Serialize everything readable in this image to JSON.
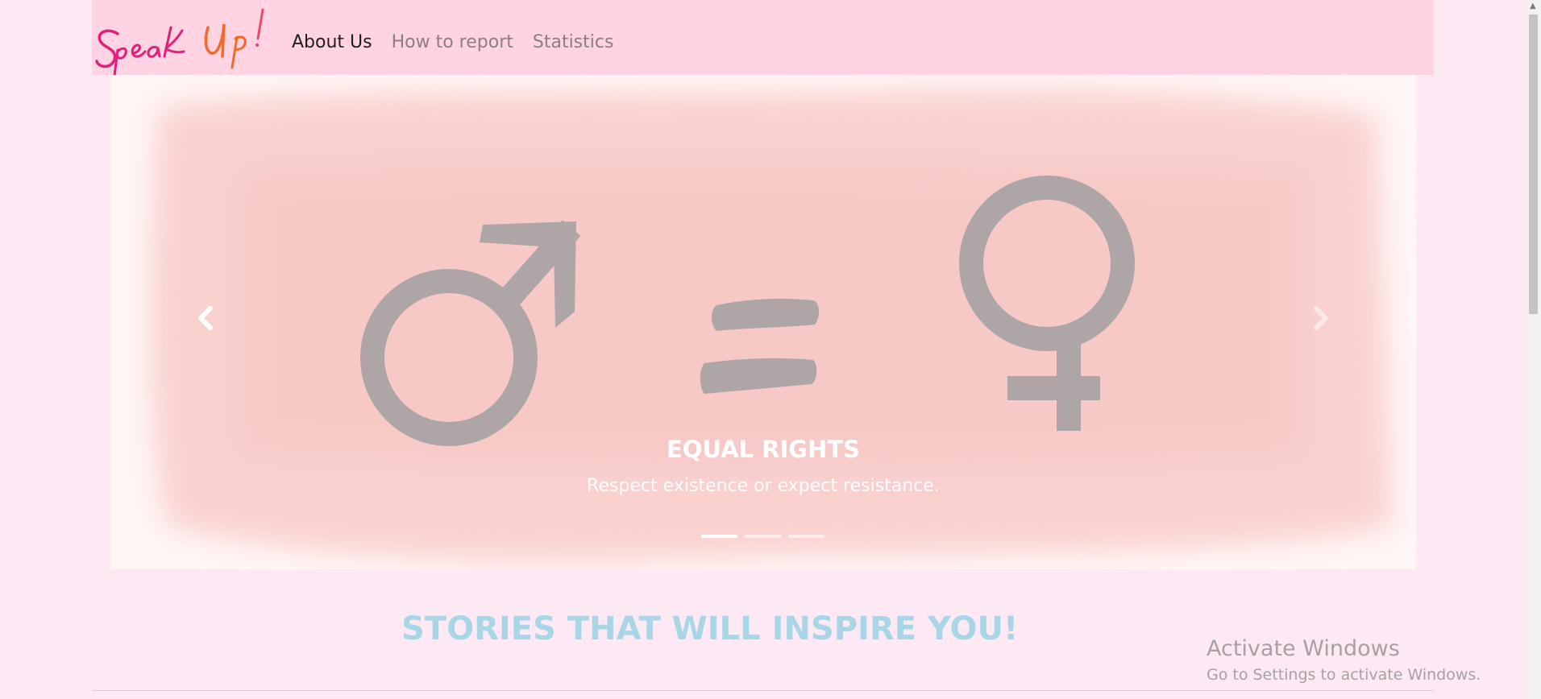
{
  "navbar": {
    "logo_text": "Speak Up!",
    "links": [
      {
        "label": "About Us",
        "active": true
      },
      {
        "label": "How to report",
        "active": false
      },
      {
        "label": "Statistics",
        "active": false
      }
    ]
  },
  "carousel": {
    "caption_title": "EQUAL RIGHTS",
    "caption_text": "Respect existence or expect resistance.",
    "slide_count": 3,
    "active_slide": 1,
    "prev_icon": "chevron-left-icon",
    "next_icon": "chevron-right-icon"
  },
  "main": {
    "heading": "STORIES THAT WILL INSPIRE YOU!"
  },
  "watermark": {
    "title": "Activate Windows",
    "subtitle": "Go to Settings to activate Windows."
  },
  "colors": {
    "background": "#fde9f4",
    "navbar": "#ffd3e1",
    "heading": "#a8d6e6",
    "symbols": "#ada5a6"
  }
}
